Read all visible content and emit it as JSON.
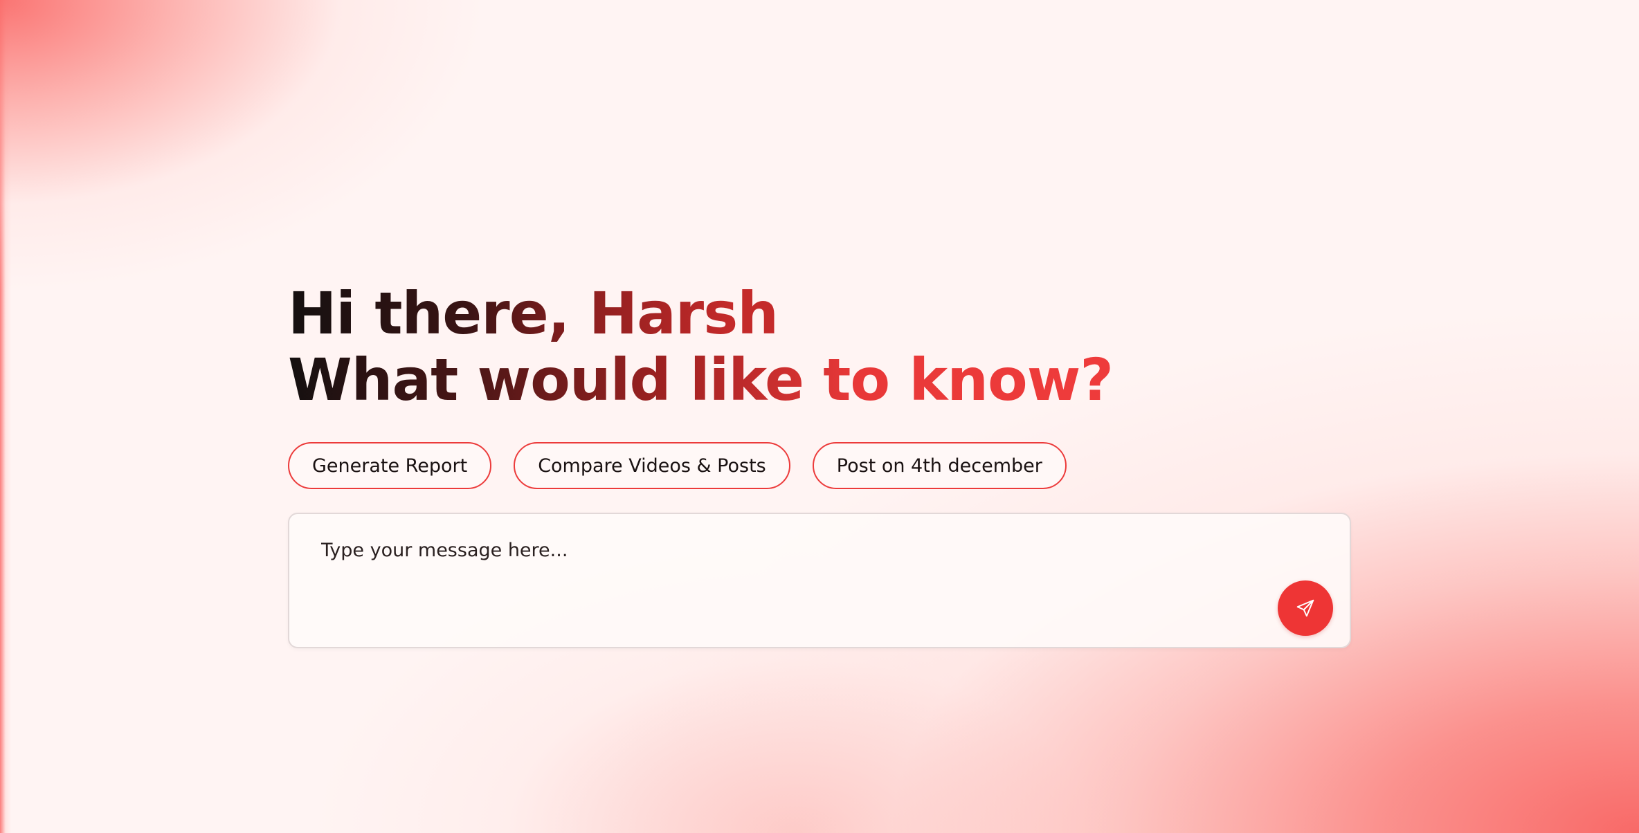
{
  "greeting": {
    "line1": "Hi there, Harsh",
    "line2": "What would like to know?"
  },
  "suggestions": [
    {
      "label": "Generate Report"
    },
    {
      "label": "Compare Videos & Posts"
    },
    {
      "label": "Post on 4th december"
    }
  ],
  "composer": {
    "value": "",
    "placeholder": "Type your message here...",
    "send_icon": "send-icon"
  },
  "colors": {
    "accent": "#ee3535",
    "chip_border": "#ec3b3b",
    "text_dark": "#141010"
  }
}
